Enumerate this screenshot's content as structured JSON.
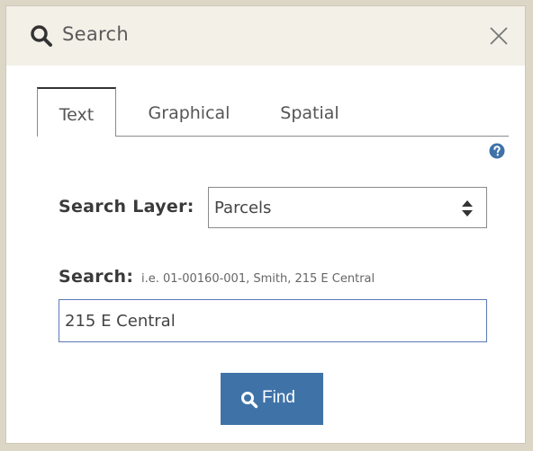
{
  "header": {
    "title": "Search",
    "search_icon": "search-icon",
    "close_icon": "close-icon"
  },
  "tabs": [
    {
      "label": "Text",
      "active": true
    },
    {
      "label": "Graphical",
      "active": false
    },
    {
      "label": "Spatial",
      "active": false
    }
  ],
  "help_icon": "question-circle-icon",
  "search_layer": {
    "label": "Search Layer:",
    "selected": "Parcels"
  },
  "search": {
    "label": "Search:",
    "hint": "i.e. 01-00160-001, Smith, 215 E Central",
    "value": "215 E Central"
  },
  "find_button": {
    "label": "Find",
    "icon": "search-icon"
  },
  "colors": {
    "header_bg": "#f3f0e8",
    "button_bg": "#3f73a8",
    "help_icon": "#3f73a8",
    "input_border": "#5b79b8"
  }
}
